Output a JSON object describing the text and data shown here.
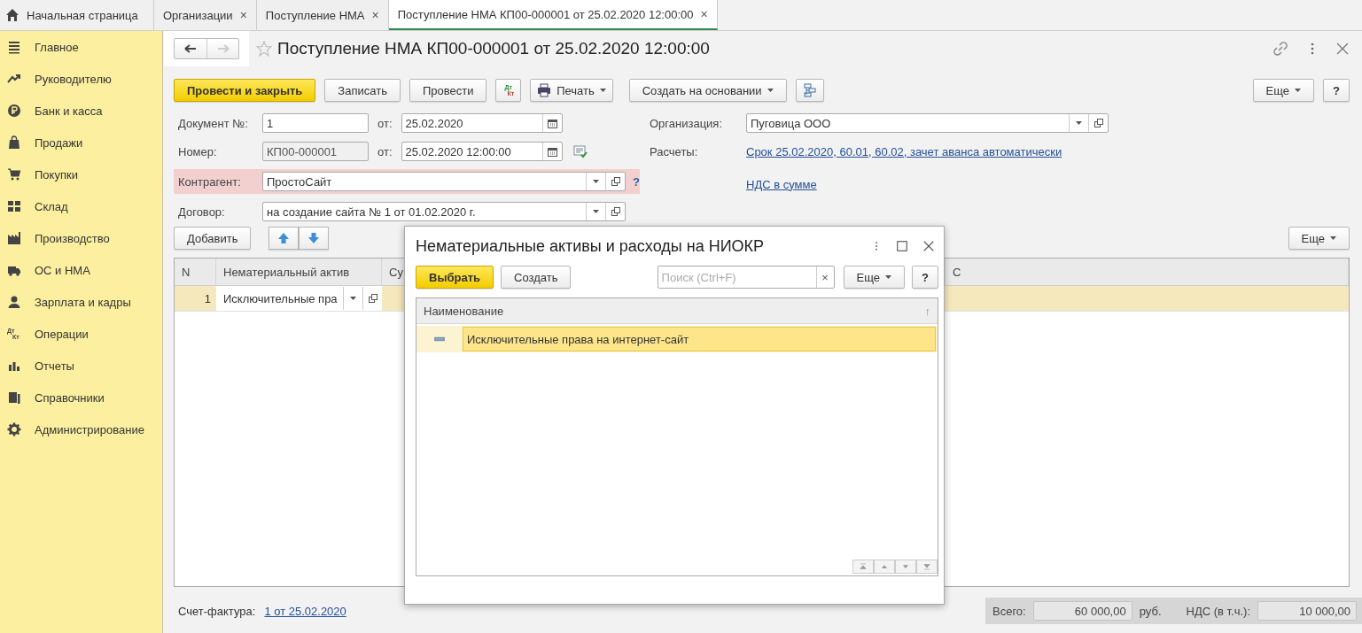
{
  "tabs": [
    {
      "label": "Начальная страница",
      "kind": "home",
      "selected": false
    },
    {
      "label": "Организации",
      "kind": "tab",
      "close": "×",
      "selected": false
    },
    {
      "label": "Поступление НМА",
      "kind": "tab",
      "close": "×",
      "selected": false
    },
    {
      "label": "Поступление НМА КП00-000001 от 25.02.2020 12:00:00",
      "kind": "tab",
      "close": "×",
      "selected": true
    }
  ],
  "sidebar": {
    "items": [
      {
        "label": "Главное"
      },
      {
        "label": "Руководителю"
      },
      {
        "label": "Банк и касса"
      },
      {
        "label": "Продажи"
      },
      {
        "label": "Покупки"
      },
      {
        "label": "Склад"
      },
      {
        "label": "Производство"
      },
      {
        "label": "ОС и НМА"
      },
      {
        "label": "Зарплата и кадры"
      },
      {
        "label": "Операции",
        "icon_top": "Дт",
        "icon_bottom": "Кт"
      },
      {
        "label": "Отчеты"
      },
      {
        "label": "Справочники"
      },
      {
        "label": "Администрирование"
      }
    ]
  },
  "document": {
    "title": "Поступление НМА КП00-000001 от 25.02.2020 12:00:00",
    "back_enabled": true,
    "forward_enabled": false,
    "commands": [
      {
        "kind": "primary",
        "label": "Провести и закрыть"
      },
      {
        "kind": "button",
        "label": "Записать"
      },
      {
        "kind": "button",
        "label": "Провести"
      },
      {
        "kind": "dtkt",
        "top": "Дт",
        "bottom": "Кт"
      },
      {
        "kind": "print",
        "label": "Печать"
      },
      {
        "kind": "dropdown",
        "label": "Создать на основании"
      },
      {
        "kind": "structure"
      }
    ],
    "more": "Еще",
    "help": "?",
    "fields_left": [
      {
        "kind": "number",
        "label": "Документ №:",
        "value": "1",
        "disabled": false,
        "date_label": "от:",
        "date": "25.02.2020",
        "posted": false
      },
      {
        "kind": "number",
        "label": "Номер:",
        "value": "КП00-000001",
        "disabled": true,
        "date_label": "от:",
        "date": "25.02.2020 12:00:00",
        "posted": true
      },
      {
        "kind": "select",
        "label": "Контрагент:",
        "value": "ПростоСайт",
        "highlighted": true,
        "help": "?"
      },
      {
        "kind": "select",
        "label": "Договор:",
        "value": "на создание сайта № 1 от 01.02.2020 г.",
        "highlighted": false
      }
    ],
    "fields_right": [
      {
        "kind": "select",
        "label": "Организация:",
        "value": "Пуговица ООО"
      },
      {
        "kind": "link",
        "label": "Расчеты:",
        "value": "Срок 25.02.2020, 60.01, 60.02, зачет аванса автоматически"
      },
      {
        "kind": "link",
        "value": "НДС в сумме"
      }
    ]
  },
  "table": {
    "add": "Добавить",
    "more": "Еще",
    "columns": [
      "N",
      "Нематериальный актив",
      "Су",
      "С"
    ],
    "rows": [
      {
        "n": "1",
        "asset": "Исключительные пра",
        "selected": true
      }
    ]
  },
  "footer": {
    "invoice_label": "Счет-фактура:",
    "invoice": "1 от 25.02.2020",
    "total_label": "Всего:",
    "total": "60 000,00",
    "currency": "руб.",
    "vat_label": "НДС (в т.ч.):",
    "vat": "10 000,00"
  },
  "dialog": {
    "title": "Нематериальные активы и расходы на НИОКР",
    "select": "Выбрать",
    "create": "Создать",
    "search": {
      "placeholder": "Поиск (Ctrl+F)"
    },
    "clear": "×",
    "more": "Еще",
    "help": "?",
    "column": "Наименование",
    "sort": "↑",
    "rows": [
      {
        "label": "Исключительные права на интернет-сайт",
        "selected": true
      }
    ]
  }
}
